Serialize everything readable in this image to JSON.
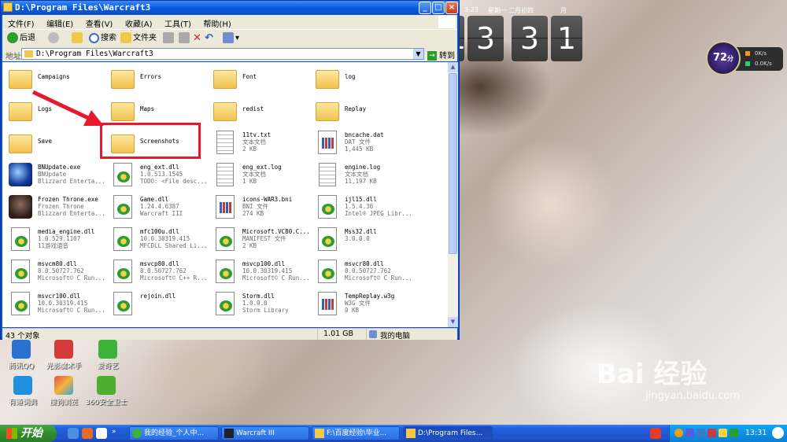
{
  "window": {
    "title": "D:\\Program Files\\Warcraft3",
    "menu": [
      "文件(F)",
      "编辑(E)",
      "查看(V)",
      "收藏(A)",
      "工具(T)",
      "帮助(H)"
    ],
    "toolbar": {
      "back": "后退",
      "search": "搜索",
      "folders": "文件夹"
    },
    "address": {
      "label": "地址(D)",
      "value": "D:\\Program Files\\Warcraft3",
      "go": "转到"
    },
    "files": [
      {
        "name": "Campaigns",
        "type": "folder"
      },
      {
        "name": "Errors",
        "type": "folder"
      },
      {
        "name": "Font",
        "type": "folder"
      },
      {
        "name": "log",
        "type": "folder"
      },
      {
        "name": "Logs",
        "type": "folder"
      },
      {
        "name": "Maps",
        "type": "folder"
      },
      {
        "name": "redist",
        "type": "folder"
      },
      {
        "name": "Replay",
        "type": "folder"
      },
      {
        "name": "Save",
        "type": "folder"
      },
      {
        "name": "Screenshots",
        "type": "folder"
      },
      {
        "name": "11tv.txt",
        "line2": "文本文档",
        "line3": "2 KB",
        "type": "doc"
      },
      {
        "name": "bncache.dat",
        "line2": "DAT 文件",
        "line3": "1,445 KB",
        "type": "bni"
      },
      {
        "name": "BNUpdate.exe",
        "line2": "BNUpdate",
        "line3": "Blizzard Enterta...",
        "type": "exe"
      },
      {
        "name": "eng_ext.dll",
        "line2": "1.0.513.1545",
        "line3": "TODO: <File desc...",
        "type": "dll"
      },
      {
        "name": "eng_ext.log",
        "line2": "文本文档",
        "line3": "1 KB",
        "type": "doc"
      },
      {
        "name": "engine.log",
        "line2": "文本文档",
        "line3": "11,197 KB",
        "type": "doc"
      },
      {
        "name": "Frozen Throne.exe",
        "line2": "Frozen Throne",
        "line3": "Blizzard Enterta...",
        "type": "exe2"
      },
      {
        "name": "Game.dll",
        "line2": "1.24.4.6387",
        "line3": "Warcraft III",
        "type": "dll"
      },
      {
        "name": "icons-WAR3.bni",
        "line2": "BNI 文件",
        "line3": "274 KB",
        "type": "bni"
      },
      {
        "name": "ijl15.dll",
        "line2": "1.5.4.36",
        "line3": "Intel® JPEG Libr...",
        "type": "dll"
      },
      {
        "name": "media_engine.dll",
        "line2": "1.0.529.1107",
        "line3": "11游戏语音",
        "type": "dll"
      },
      {
        "name": "mfc100u.dll",
        "line2": "10.0.30319.415",
        "line3": "MFCDLL Shared Li...",
        "type": "dll"
      },
      {
        "name": "Microsoft.VC80.C...",
        "line2": "MANIFEST 文件",
        "line3": "2 KB",
        "type": "dll"
      },
      {
        "name": "Mss32.dll",
        "line2": "3.0.0.0",
        "line3": "",
        "type": "dll"
      },
      {
        "name": "msvcm80.dll",
        "line2": "8.0.50727.762",
        "line3": "Microsoft© C Run...",
        "type": "dll"
      },
      {
        "name": "msvcp80.dll",
        "line2": "8.0.50727.762",
        "line3": "Microsoft© C++ R...",
        "type": "dll"
      },
      {
        "name": "msvcp100.dll",
        "line2": "10.0.30319.415",
        "line3": "Microsoft© C Run...",
        "type": "dll"
      },
      {
        "name": "msvcr80.dll",
        "line2": "8.0.50727.762",
        "line3": "Microsoft© C Run...",
        "type": "dll"
      },
      {
        "name": "msvcr100.dll",
        "line2": "10.0.30319.415",
        "line3": "Microsoft© C Run...",
        "type": "dll"
      },
      {
        "name": "rejoin.dll",
        "line2": "",
        "line3": "",
        "type": "dll"
      },
      {
        "name": "Storm.dll",
        "line2": "1.0.9.0",
        "line3": "Storm Library",
        "type": "dll"
      },
      {
        "name": "TempReplay.w3g",
        "line2": "W3G 文件",
        "line3": "9 KB",
        "type": "bni"
      }
    ],
    "status": {
      "count": "43 个对象",
      "size": "1.01 GB",
      "location": "我的电脑"
    }
  },
  "clock": {
    "date": "3.23",
    "weekday": "星期一",
    "lunar": "二月初四",
    "month_label": "月",
    "digits": [
      "1",
      "3",
      "3",
      "1"
    ]
  },
  "score": {
    "value": "72",
    "unit": "分",
    "up": "0K/s",
    "down": "0.0K/s"
  },
  "desktop_icons": [
    {
      "label": "腾讯QQ"
    },
    {
      "label": "光影魔术手"
    },
    {
      "label": "爱奇艺"
    },
    {
      "label": "有道词典"
    },
    {
      "label": "搜狗浏览"
    },
    {
      "label": "360安全卫士"
    }
  ],
  "watermark": {
    "brand": "Bai 经验",
    "url": "jingyan.baidu.com"
  },
  "taskbar": {
    "start": "开始",
    "tasks": [
      "我的经验_个人中...",
      "Warcraft III",
      "F:\\百度经验\\毕业...",
      "D:\\Program Files..."
    ],
    "time": "13:31"
  },
  "colors": {
    "highlight": "#e8192c",
    "titlebar": "#0a5be0",
    "taskbar": "#245edb"
  }
}
